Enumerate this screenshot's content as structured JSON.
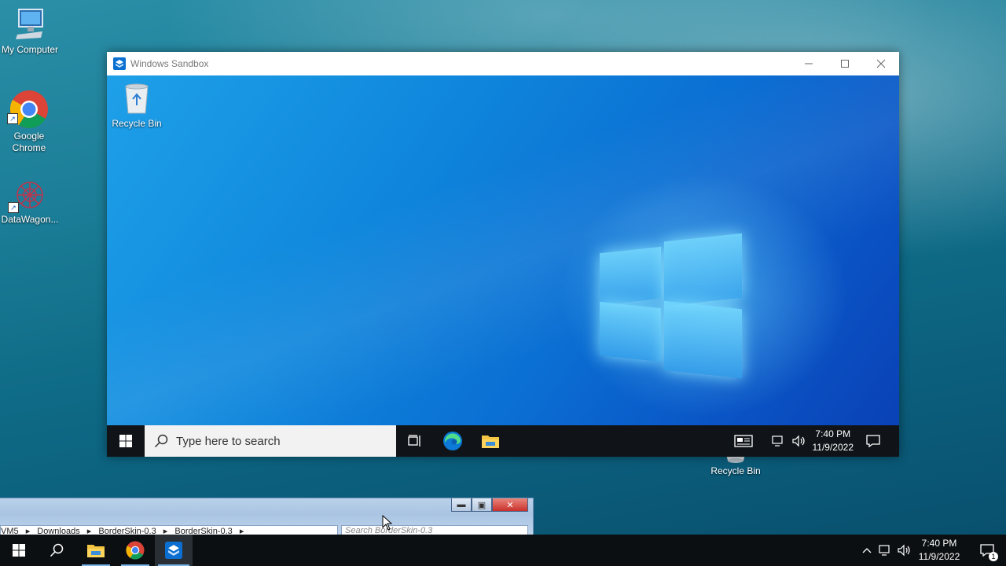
{
  "desktop": {
    "icons": [
      {
        "label": "My Computer"
      },
      {
        "label": "Google Chrome"
      },
      {
        "label": "DataWagon..."
      }
    ],
    "recycle_label": "Recycle Bin"
  },
  "sandbox_window": {
    "title": "Windows Sandbox",
    "desktop_icon_label": "Recycle Bin",
    "taskbar": {
      "search_placeholder": "Type here to search",
      "time": "7:40 PM",
      "date": "11/9/2022"
    }
  },
  "explorer": {
    "breadcrumb": [
      "VM5",
      "Downloads",
      "BorderSkin-0.3",
      "BorderSkin-0.3"
    ],
    "search_placeholder": "Search BorderSkin-0.3"
  },
  "taskbar": {
    "time": "7:40 PM",
    "date": "11/9/2022",
    "notification_count": "1"
  },
  "colors": {
    "sandbox_accent": "#0a74d8",
    "taskbar_bg": "#0c0f12",
    "close_red": "#c9302c"
  }
}
